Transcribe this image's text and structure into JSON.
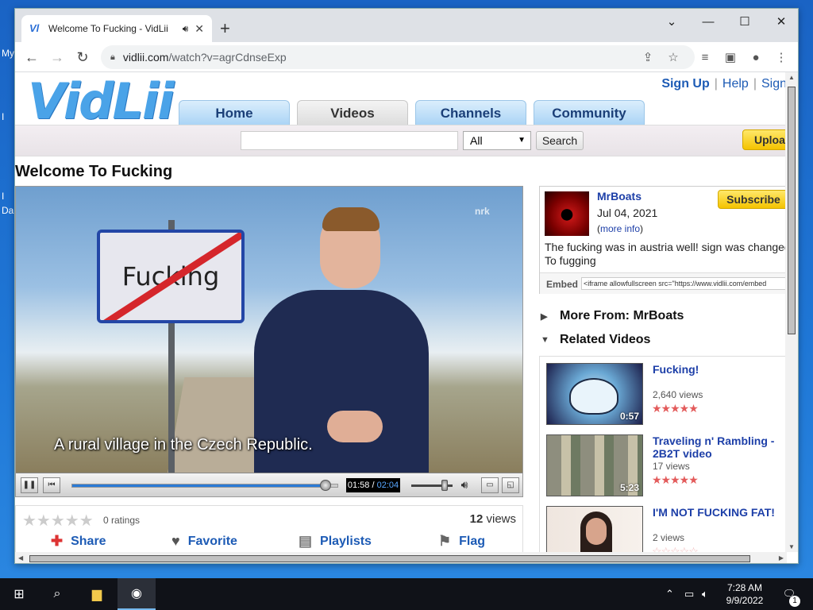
{
  "browser": {
    "tab_title": "Welcome To Fucking - VidLii",
    "tab_favicon": "Vl",
    "url_host": "vidlii.com",
    "url_path": "/watch?v=agrCdnseExp"
  },
  "site": {
    "logo": "VidLii",
    "top_links": [
      "Sign Up",
      "Help",
      "Sign"
    ],
    "nav_tabs": [
      "Home",
      "Videos",
      "Channels",
      "Community"
    ],
    "search": {
      "value": "",
      "category": "All",
      "button": "Search"
    },
    "upload_label": "Upload"
  },
  "video": {
    "title": "Welcome To Fucking",
    "sign_text": "Fucking",
    "watermark": "nrk",
    "subtitle": "A rural village in the Czech Republic.",
    "current_time": "01:58",
    "duration": "02:04",
    "progress_fraction": 0.951,
    "volume_fraction": 0.8,
    "ratings_text": "0 ratings",
    "rating_stars": 0,
    "views_count": "12",
    "views_label": "views",
    "actions": [
      "Share",
      "Favorite",
      "Playlists",
      "Flag"
    ]
  },
  "uploader": {
    "name": "MrBoats",
    "date": "Jul 04, 2021",
    "more_info": "more info",
    "subscribe_label": "Subscribe",
    "description": "The fucking was in austria well! sign was changed To fugging",
    "embed_label": "Embed",
    "embed_code": "<iframe allowfullscreen src=\"https://www.vidlii.com/embed"
  },
  "sections": {
    "more_from": "More From: MrBoats",
    "related": "Related Videos"
  },
  "related": [
    {
      "title": "Fucking!",
      "views": "2,640 views",
      "duration": "0:57",
      "stars": 5
    },
    {
      "title": "Traveling n' Rambling - 2B2T video",
      "views": "17 views",
      "duration": "5:23",
      "stars": 5
    },
    {
      "title": "I'M NOT FUCKING FAT!",
      "views": "2 views",
      "duration": "",
      "stars": 0
    }
  ],
  "desktop_labels": [
    "My",
    "I",
    "I",
    "Da"
  ],
  "taskbar": {
    "time": "7:28 AM",
    "date": "9/9/2022",
    "notification_count": "1"
  }
}
